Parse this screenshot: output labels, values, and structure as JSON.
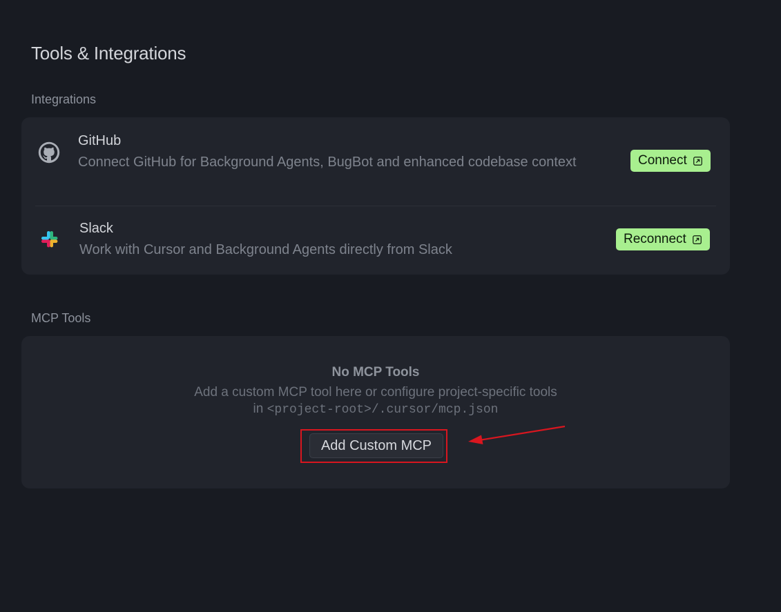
{
  "page": {
    "title": "Tools & Integrations"
  },
  "integrations": {
    "section_label": "Integrations",
    "items": [
      {
        "name": "GitHub",
        "description": "Connect GitHub for Background Agents, BugBot and enhanced codebase context",
        "button_label": "Connect",
        "icon": "github-icon"
      },
      {
        "name": "Slack",
        "description": "Work with Cursor and Background Agents directly from Slack",
        "button_label": "Reconnect",
        "icon": "slack-icon"
      }
    ]
  },
  "mcp": {
    "section_label": "MCP Tools",
    "empty_title": "No MCP Tools",
    "empty_desc_line1": "Add a custom MCP tool here or configure project-specific tools",
    "empty_desc_in": "in",
    "empty_desc_path": "<project-root>/.cursor/mcp.json",
    "add_button_label": "Add Custom MCP"
  },
  "colors": {
    "background": "#181b22",
    "card": "#21242c",
    "accent_green": "#a8ef8f",
    "annotation_red": "#d9161f"
  }
}
